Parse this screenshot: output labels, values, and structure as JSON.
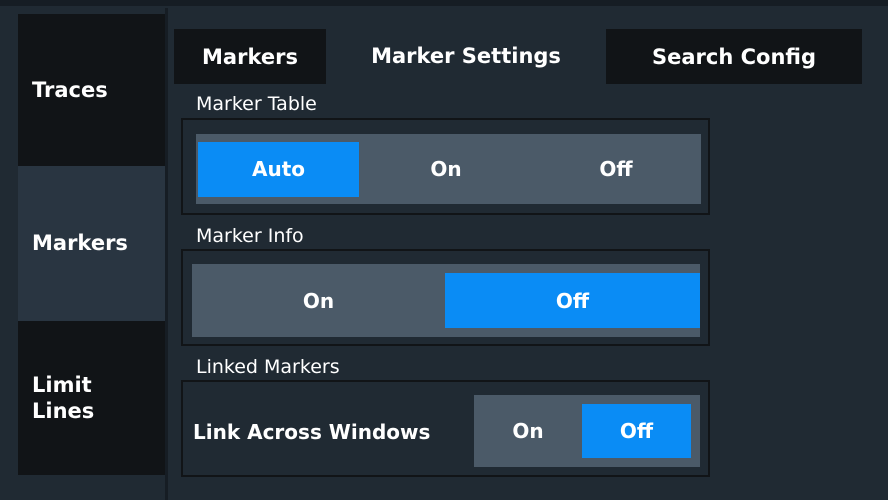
{
  "side_tabs": [
    {
      "label": "Traces",
      "active": false
    },
    {
      "label": "Markers",
      "active": true
    },
    {
      "label": "Limit\nLines",
      "active": false
    }
  ],
  "top_tabs": [
    {
      "label": "Markers",
      "active": false
    },
    {
      "label": "Marker Settings",
      "active": true
    },
    {
      "label": "Search Config",
      "active": false
    }
  ],
  "marker_table": {
    "title": "Marker Table",
    "options": [
      "Auto",
      "On",
      "Off"
    ],
    "selected": "Auto"
  },
  "marker_info": {
    "title": "Marker Info",
    "options": [
      "On",
      "Off"
    ],
    "selected": "Off"
  },
  "linked_markers": {
    "title": "Linked Markers",
    "link_label": "Link Across Windows",
    "options": [
      "On",
      "Off"
    ],
    "selected": "Off"
  },
  "colors": {
    "accent": "#0a8cf5",
    "background": "#202a33",
    "inactive_tab": "#111417",
    "segment": "#4b5a68"
  }
}
